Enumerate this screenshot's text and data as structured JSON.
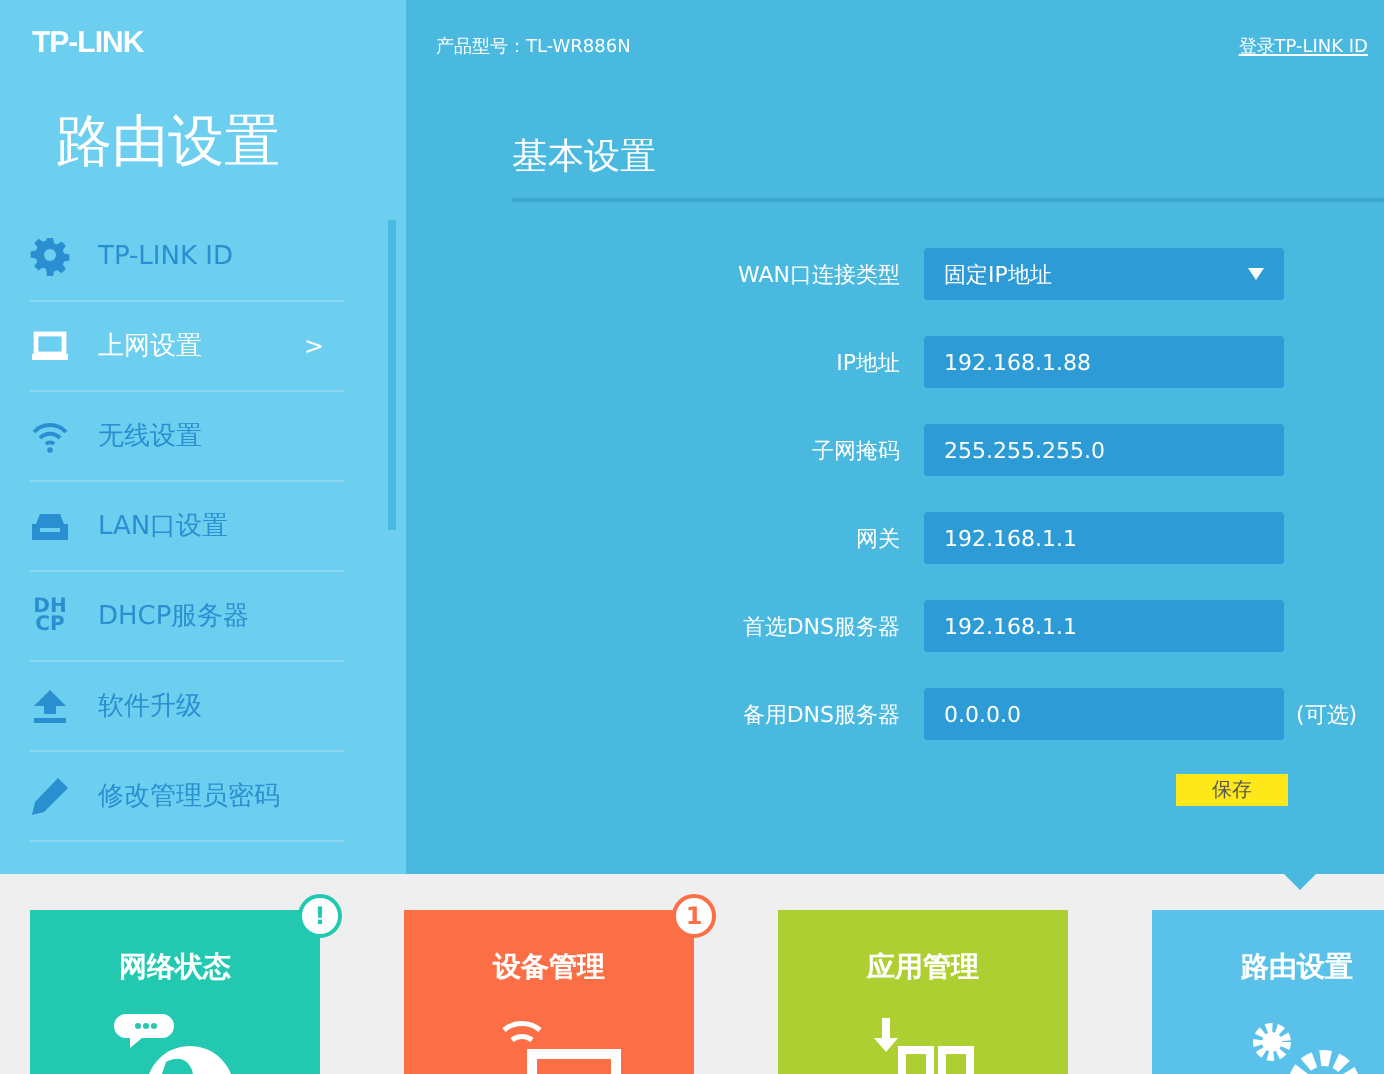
{
  "header": {
    "logo": "TP-LINK",
    "model": "产品型号：TL-WR886N",
    "login_link": "登录TP-LINK ID"
  },
  "sidebar": {
    "title": "路由设置",
    "items": [
      {
        "kind": "gear",
        "label": "TP-LINK ID",
        "selected": false
      },
      {
        "kind": "laptop",
        "label": "上网设置",
        "selected": true,
        "chevron": ">"
      },
      {
        "kind": "wifi",
        "label": "无线设置",
        "selected": false
      },
      {
        "kind": "lan",
        "label": "LAN口设置",
        "selected": false
      },
      {
        "kind": "dhcp",
        "icon_text": "DH CP",
        "label": "DHCP服务器",
        "selected": false
      },
      {
        "kind": "upload",
        "label": "软件升级",
        "selected": false
      },
      {
        "kind": "pencil",
        "label": "修改管理员密码",
        "selected": false
      }
    ]
  },
  "form": {
    "title": "基本设置",
    "fields": [
      {
        "kind": "select",
        "label": "WAN口连接类型",
        "value": "固定IP地址"
      },
      {
        "kind": "input",
        "label": "IP地址",
        "value": "192.168.1.88"
      },
      {
        "kind": "input",
        "label": "子网掩码",
        "value": "255.255.255.0"
      },
      {
        "kind": "input",
        "label": "网关",
        "value": "192.168.1.1"
      },
      {
        "kind": "input",
        "label": "首选DNS服务器",
        "value": "192.168.1.1"
      },
      {
        "kind": "input",
        "label": "备用DNS服务器",
        "value": "0.0.0.0",
        "note": "(可选)"
      }
    ],
    "save_button": "保存"
  },
  "tiles": [
    {
      "label": "网络状态",
      "color": "#22c9b0",
      "badge": "!",
      "kind": "globe",
      "selected": false
    },
    {
      "label": "设备管理",
      "color": "#fc6e45",
      "badge": "1",
      "kind": "device",
      "selected": false
    },
    {
      "label": "应用管理",
      "color": "#aecf32",
      "kind": "apps",
      "selected": false
    },
    {
      "label": "路由设置",
      "color": "#5ac2ea",
      "kind": "gears",
      "selected": true
    }
  ]
}
